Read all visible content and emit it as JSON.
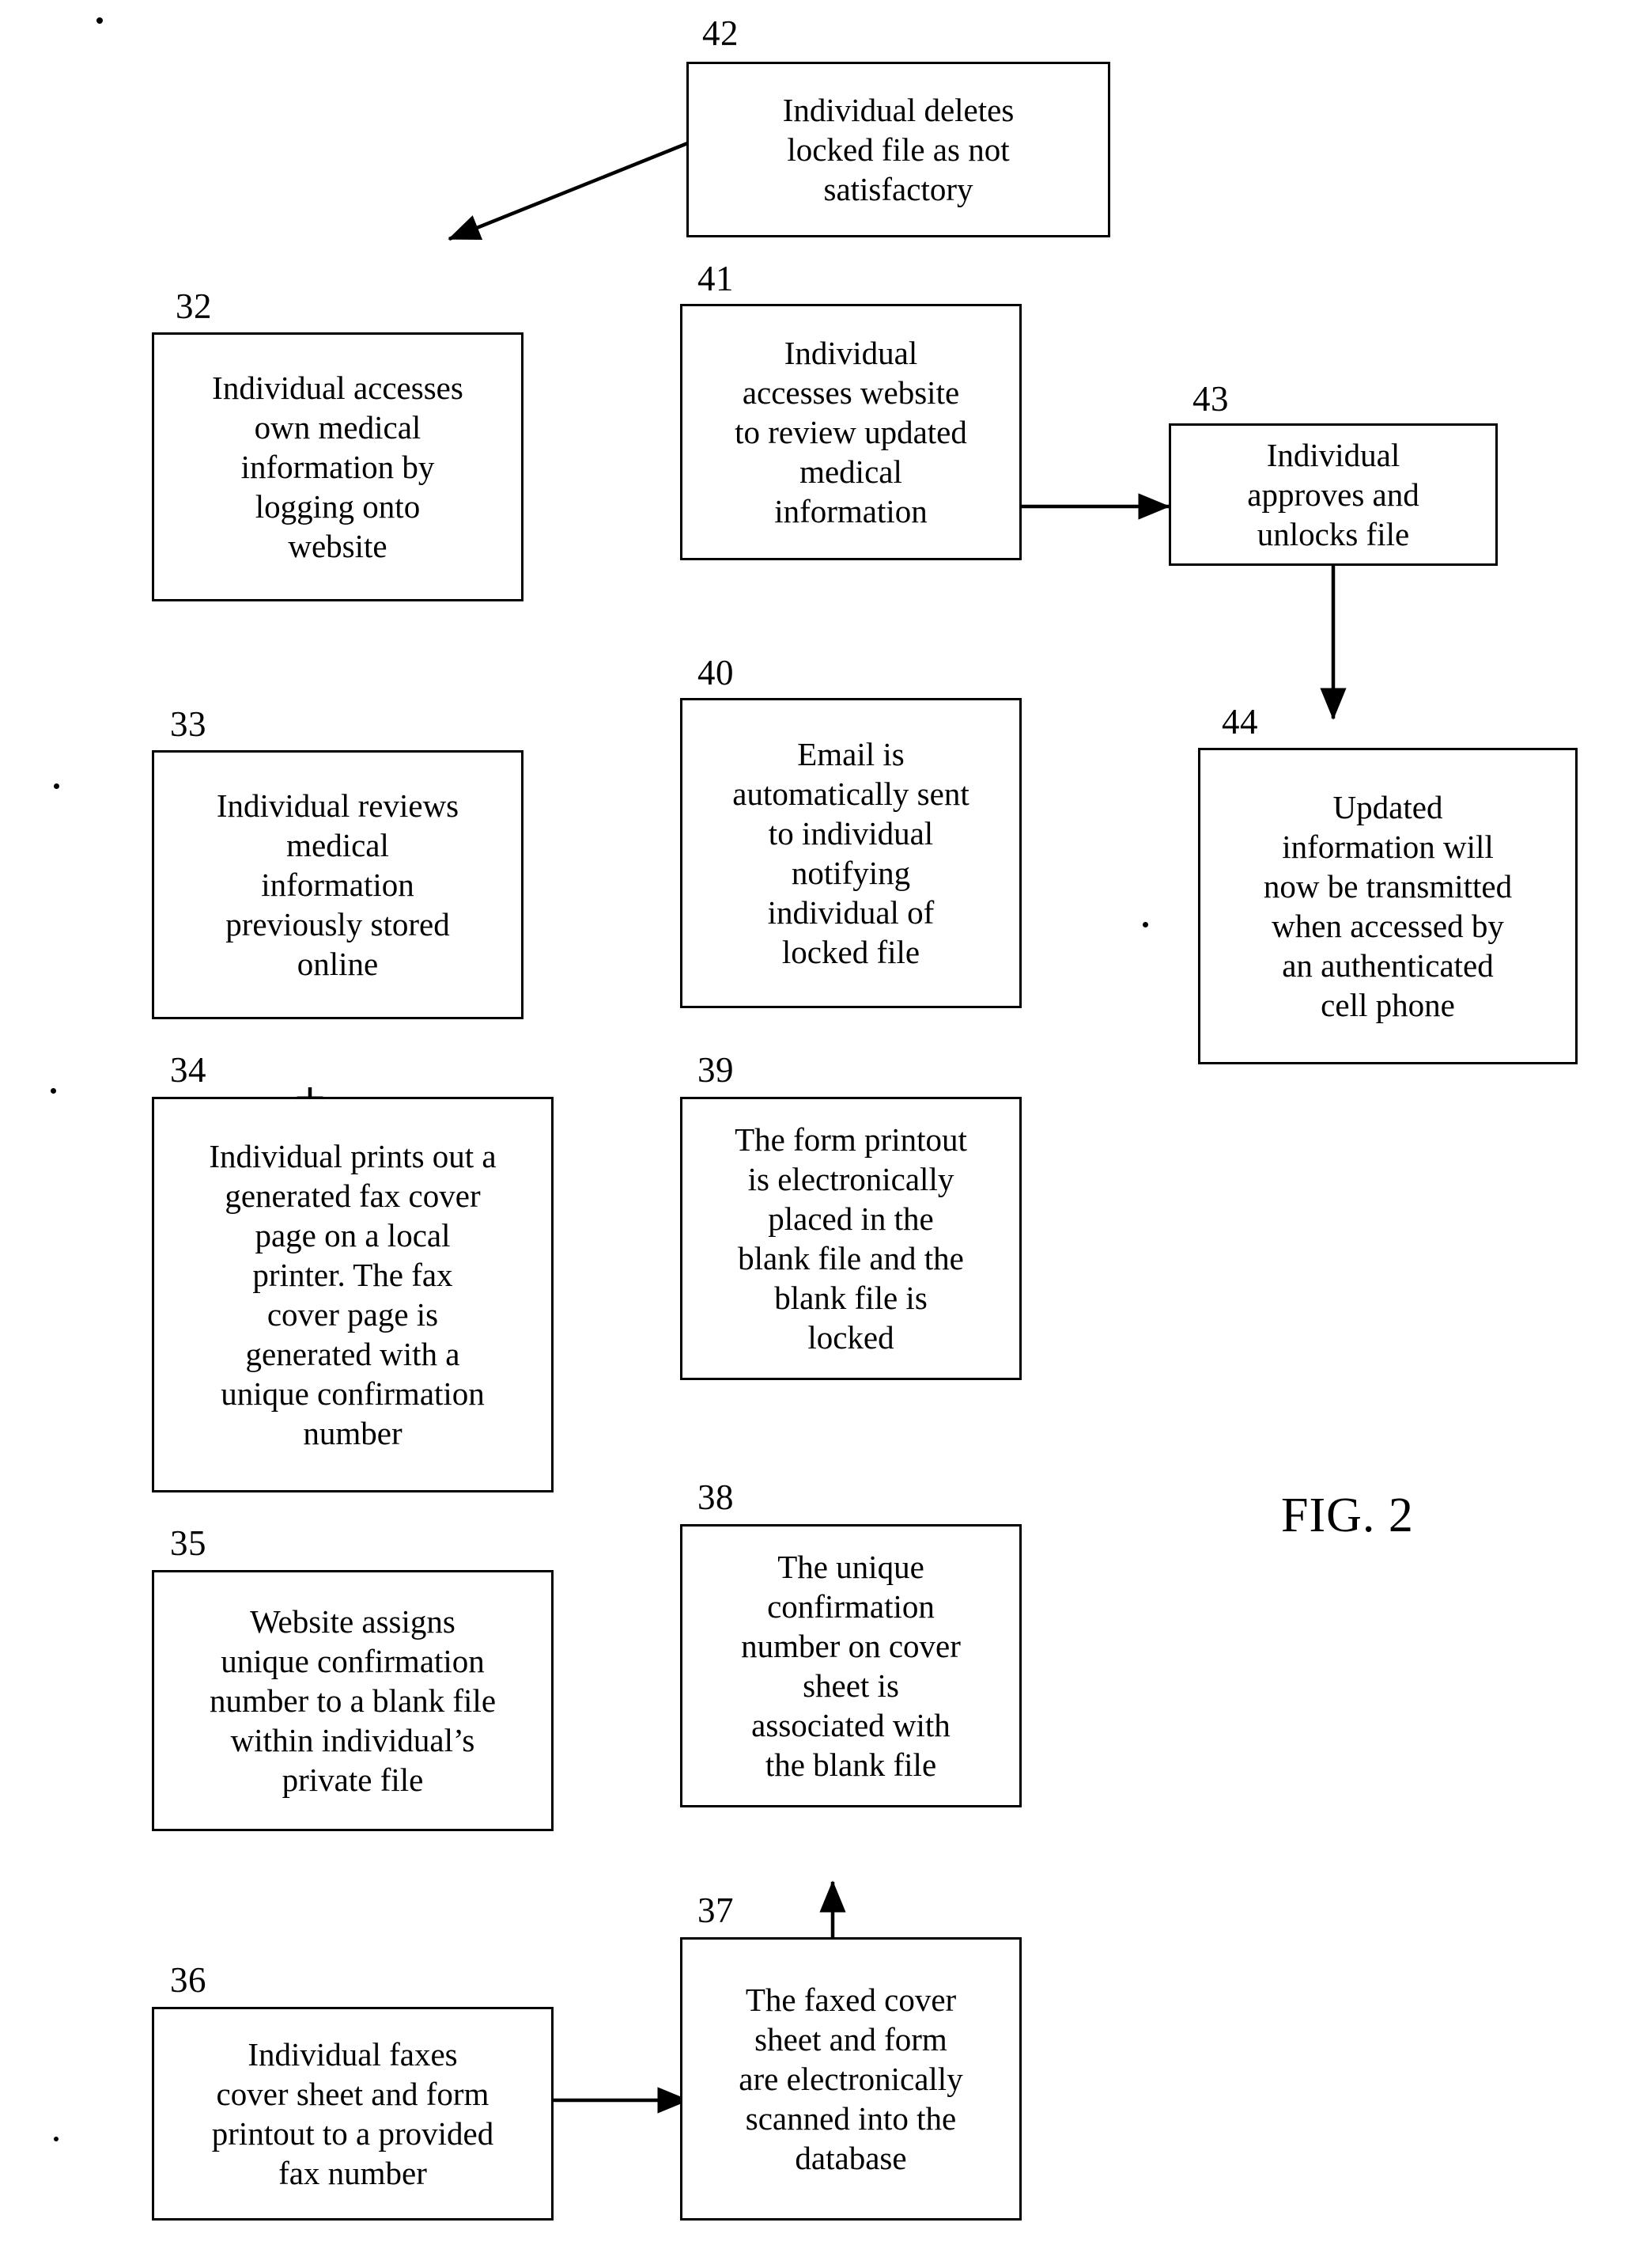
{
  "figure": {
    "label": "FIG. 2",
    "type": "patent-flowchart"
  },
  "nodes": [
    {
      "ref": "42",
      "text": "Individual deletes\nlocked file as not\nsatisfactory"
    },
    {
      "ref": "32",
      "text": "Individual accesses\nown medical\ninformation by\nlogging onto\nwebsite"
    },
    {
      "ref": "41",
      "text": "Individual\naccesses website\nto review updated\nmedical\ninformation"
    },
    {
      "ref": "43",
      "text": "Individual\napproves and\nunlocks file"
    },
    {
      "ref": "40",
      "text": "Email is\nautomatically sent\nto individual\nnotifying\nindividual of\nlocked file"
    },
    {
      "ref": "44",
      "text": "Updated\ninformation will\nnow be transmitted\nwhen accessed by\nan authenticated\ncell phone"
    },
    {
      "ref": "33",
      "text": "Individual reviews\nmedical\ninformation\npreviously stored\nonline"
    },
    {
      "ref": "34",
      "text": "Individual prints out a\ngenerated fax cover\npage on a local\nprinter.  The fax\ncover page is\ngenerated with a\nunique confirmation\nnumber"
    },
    {
      "ref": "39",
      "text": "The form printout\nis electronically\nplaced in the\nblank file and the\nblank file is\nlocked"
    },
    {
      "ref": "35",
      "text": "Website assigns\nunique confirmation\nnumber to a blank file\nwithin individual’s\nprivate file"
    },
    {
      "ref": "38",
      "text": "The unique\nconfirmation\nnumber on cover\nsheet is\nassociated with\nthe blank file"
    },
    {
      "ref": "36",
      "text": "Individual faxes\ncover sheet and form\nprintout to a provided\nfax number"
    },
    {
      "ref": "37",
      "text": "The faxed cover\nsheet and form\nare electronically\nscanned into the\ndatabase"
    }
  ],
  "edges": [
    {
      "from": "42",
      "to": "32",
      "style": "diagonal-arrow"
    },
    {
      "from": "32",
      "to": "33",
      "style": "vertical-arrow"
    },
    {
      "from": "33",
      "to": "34",
      "style": "vertical-arrow"
    },
    {
      "from": "34",
      "to": "35",
      "style": "vertical-arrow"
    },
    {
      "from": "35",
      "to": "36",
      "style": "vertical-arrow"
    },
    {
      "from": "36",
      "to": "37",
      "style": "horizontal-arrow"
    },
    {
      "from": "37",
      "to": "38",
      "style": "vertical-arrow-up"
    },
    {
      "from": "38",
      "to": "39",
      "style": "vertical-arrow-up"
    },
    {
      "from": "39",
      "to": "40",
      "style": "vertical-arrow-up"
    },
    {
      "from": "40",
      "to": "41",
      "style": "vertical-arrow-up"
    },
    {
      "from": "41",
      "to": "42",
      "style": "vertical-arrow-up"
    },
    {
      "from": "41",
      "to": "43",
      "style": "horizontal-arrow"
    },
    {
      "from": "43",
      "to": "44",
      "style": "vertical-arrow"
    }
  ],
  "colors": {
    "ink": "#000000",
    "paper": "#ffffff"
  }
}
